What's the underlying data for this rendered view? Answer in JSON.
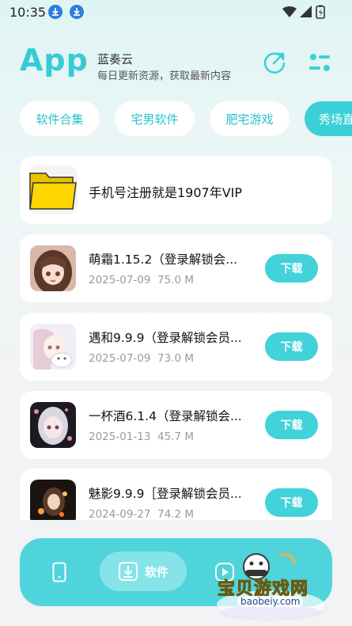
{
  "status_bar": {
    "time": "10:35",
    "download_icons": [
      "download-icon",
      "download-icon"
    ],
    "system_icons": [
      "wifi-icon",
      "signal-icon",
      "battery-icon"
    ]
  },
  "header": {
    "brand": "App",
    "title": "蓝奏云",
    "subtitle": "每日更新资源，获取最新内容",
    "actions": [
      "share-icon",
      "settings-sliders-icon"
    ]
  },
  "tabs": [
    {
      "label": "软件合集",
      "active": false
    },
    {
      "label": "宅男软件",
      "active": false
    },
    {
      "label": "肥宅游戏",
      "active": false
    },
    {
      "label": "秀场直",
      "active": true
    }
  ],
  "folder": {
    "label": "手机号注册就是1907年VIP",
    "icon": "folder-icon"
  },
  "apps": [
    {
      "name": "萌霜1.15.2（登录解锁会...",
      "date": "2025-07-09",
      "size": "75.0 M",
      "button": "下载"
    },
    {
      "name": "遇和9.9.9（登录解锁会员...",
      "date": "2025-07-09",
      "size": "73.0 M",
      "button": "下载"
    },
    {
      "name": "一杯酒6.1.4（登录解锁会...",
      "date": "2025-01-13",
      "size": "45.7 M",
      "button": "下载"
    },
    {
      "name": "魅影9.9.9［登录解锁会员...",
      "date": "2024-09-27",
      "size": "74.2 M",
      "button": "下载"
    }
  ],
  "bottom_nav": {
    "items": [
      {
        "icon": "phone-icon",
        "label": ""
      },
      {
        "icon": "download-box-icon",
        "label": "软件"
      },
      {
        "icon": "play-icon",
        "label": ""
      }
    ]
  },
  "watermark": {
    "text": "宝贝游戏网",
    "url": "baobeiy.com"
  },
  "colors": {
    "accent": "#3bd0d8",
    "brand": "#35ccd6",
    "folder": "#ffd600",
    "nav_bar": "#4fd4dc"
  }
}
